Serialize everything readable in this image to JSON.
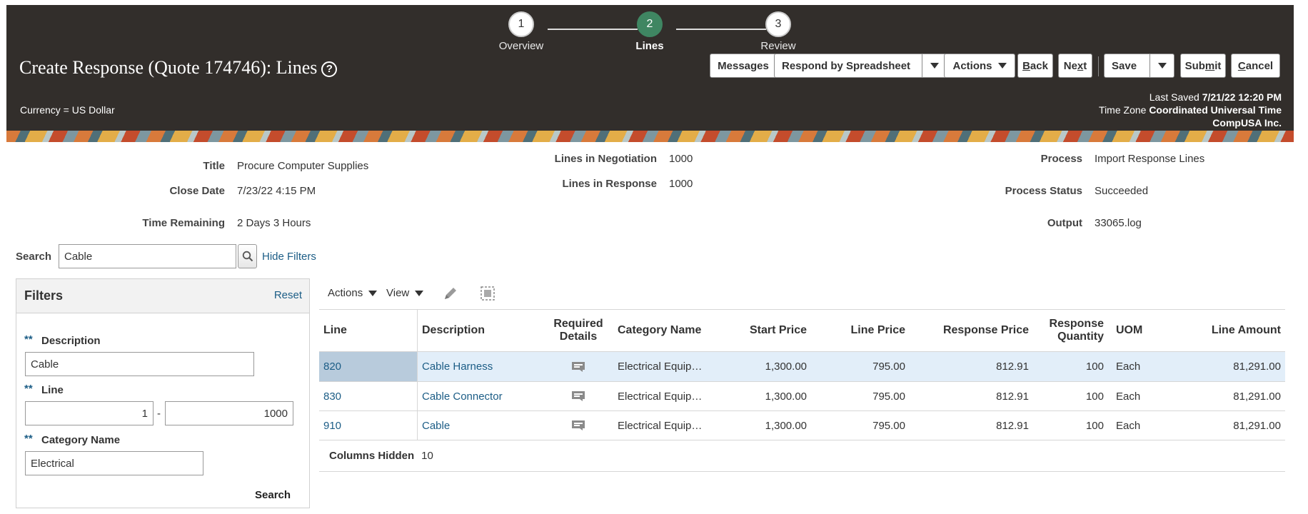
{
  "train": [
    {
      "num": "1",
      "label": "Overview"
    },
    {
      "num": "2",
      "label": "Lines"
    },
    {
      "num": "3",
      "label": "Review"
    }
  ],
  "header": {
    "title": "Create Response (Quote 174746): Lines",
    "help": "?",
    "currency": "Currency = US Dollar",
    "last_saved_label": "Last Saved",
    "last_saved_value": "7/21/22 12:20 PM",
    "timezone_label": "Time Zone",
    "timezone_value": "Coordinated Universal Time",
    "company": "CompUSA Inc."
  },
  "toolbar": {
    "messages": "Messages",
    "respond_spreadsheet": "Respond by Spreadsheet",
    "actions": "Actions",
    "back_pre": "",
    "back_u": "B",
    "back_post": "ack",
    "next_pre": "Ne",
    "next_u": "x",
    "next_post": "t",
    "save": "Save",
    "submit_pre": "Sub",
    "submit_u": "m",
    "submit_post": "it",
    "cancel_pre": "",
    "cancel_u": "C",
    "cancel_post": "ancel"
  },
  "summary": {
    "title_label": "Title",
    "title_value": "Procure Computer Supplies",
    "close_label": "Close Date",
    "close_value": "7/23/22 4:15 PM",
    "remain_label": "Time Remaining",
    "remain_value": "2 Days 3 Hours",
    "neg_label": "Lines in Negotiation",
    "neg_value": "1000",
    "resp_label": "Lines in Response",
    "resp_value": "1000",
    "process_label": "Process",
    "process_value": "Import Response Lines",
    "status_label": "Process Status",
    "status_value": "Succeeded",
    "output_label": "Output",
    "output_value": "33065.log"
  },
  "search": {
    "label": "Search",
    "value": "Cable",
    "hide_filters": "Hide Filters"
  },
  "filters": {
    "title": "Filters",
    "reset": "Reset",
    "req_mark": "**",
    "desc_label": "Description",
    "desc_value": "Cable",
    "line_label": "Line",
    "line_from": "1",
    "line_to": "1000",
    "line_dash": "-",
    "cat_label": "Category Name",
    "cat_value": "Electrical",
    "search_btn": "Search"
  },
  "table_tools": {
    "actions": "Actions",
    "view": "View"
  },
  "table": {
    "headers": {
      "line": "Line",
      "description": "Description",
      "required_details": "Required Details",
      "category": "Category Name",
      "start_price": "Start Price",
      "line_price": "Line Price",
      "response_price": "Response Price",
      "response_qty": "Response Quantity",
      "uom": "UOM",
      "line_amount": "Line Amount"
    },
    "rows": [
      {
        "line": "820",
        "description": "Cable Harness",
        "category": "Electrical Equip…",
        "start_price": "1,300.00",
        "line_price": "795.00",
        "response_price": "812.91",
        "qty": "100",
        "uom": "Each",
        "amount": "81,291.00"
      },
      {
        "line": "830",
        "description": "Cable Connector",
        "category": "Electrical Equip…",
        "start_price": "1,300.00",
        "line_price": "795.00",
        "response_price": "812.91",
        "qty": "100",
        "uom": "Each",
        "amount": "81,291.00"
      },
      {
        "line": "910",
        "description": "Cable",
        "category": "Electrical Equip…",
        "start_price": "1,300.00",
        "line_price": "795.00",
        "response_price": "812.91",
        "qty": "100",
        "uom": "Each",
        "amount": "81,291.00"
      }
    ],
    "columns_hidden_label": "Columns Hidden",
    "columns_hidden_value": "10"
  },
  "colors": {
    "header_bg": "#322e2b",
    "active_step": "#3f8662",
    "link": "#1c5d86",
    "selected_row": "#e2eef9"
  }
}
